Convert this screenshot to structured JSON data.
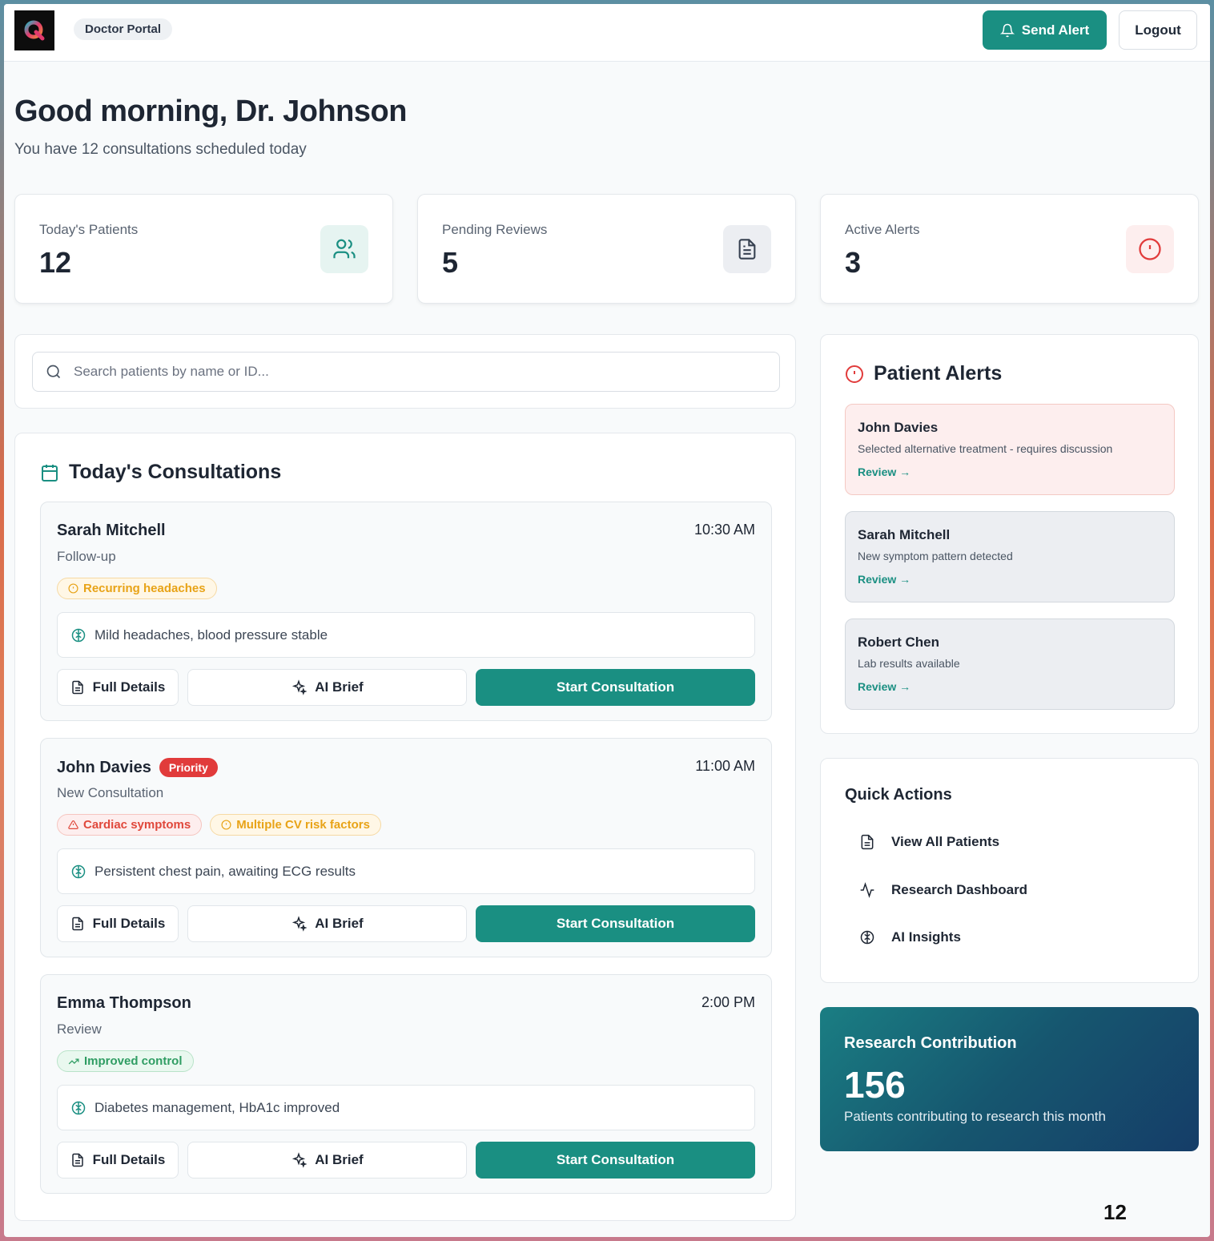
{
  "header": {
    "portal_label": "Doctor Portal",
    "send_alert_label": "Send Alert",
    "logout_label": "Logout"
  },
  "greeting": {
    "title": "Good morning, Dr. Johnson",
    "subtitle": "You have 12 consultations scheduled today"
  },
  "stats": [
    {
      "label": "Today's Patients",
      "value": "12",
      "icon": "users-icon",
      "color": "#1a8f82"
    },
    {
      "label": "Pending Reviews",
      "value": "5",
      "icon": "document-icon",
      "color": "#374151"
    },
    {
      "label": "Active Alerts",
      "value": "3",
      "icon": "alert-circle-icon",
      "color": "#e13b3b"
    }
  ],
  "search": {
    "placeholder": "Search patients by name or ID...",
    "value": ""
  },
  "consultations": {
    "title": "Today's Consultations",
    "items": [
      {
        "name": "Sarah Mitchell",
        "time": "10:30 AM",
        "kind": "Follow-up",
        "tags": [
          {
            "label": "Recurring headaches",
            "style": "warn"
          }
        ],
        "note": "Mild headaches, blood pressure stable",
        "full_details": "Full Details",
        "ai_brief": "AI Brief",
        "start": "Start Consultation"
      },
      {
        "name": "John Davies",
        "badge": "Priority",
        "time": "11:00 AM",
        "kind": "New Consultation",
        "tags": [
          {
            "label": "Cardiac symptoms",
            "style": "danger"
          },
          {
            "label": "Multiple CV risk factors",
            "style": "warn"
          }
        ],
        "note": "Persistent chest pain, awaiting ECG results",
        "full_details": "Full Details",
        "ai_brief": "AI Brief",
        "start": "Start Consultation"
      },
      {
        "name": "Emma Thompson",
        "time": "2:00 PM",
        "kind": "Review",
        "tags": [
          {
            "label": "Improved control",
            "style": "good"
          }
        ],
        "note": "Diabetes management, HbA1c improved",
        "full_details": "Full Details",
        "ai_brief": "AI Brief",
        "start": "Start Consultation"
      }
    ]
  },
  "alerts": {
    "title": "Patient Alerts",
    "items": [
      {
        "name": "John Davies",
        "desc": "Selected alternative treatment - requires discussion",
        "action": "Review →",
        "style": "red"
      },
      {
        "name": "Sarah Mitchell",
        "desc": "New symptom pattern detected",
        "action": "Review →",
        "style": "grey"
      },
      {
        "name": "Robert Chen",
        "desc": "Lab results available",
        "action": "Review →",
        "style": "grey"
      }
    ]
  },
  "quick_actions": {
    "title": "Quick Actions",
    "items": [
      {
        "label": "View All Patients",
        "icon": "document-icon"
      },
      {
        "label": "Research Dashboard",
        "icon": "activity-icon"
      },
      {
        "label": "AI Insights",
        "icon": "brain-icon"
      }
    ]
  },
  "research": {
    "title": "Research Contribution",
    "value": "156",
    "desc": "Patients contributing to research this month"
  },
  "page_number": "12",
  "colors": {
    "primary": "#1a8f82",
    "danger": "#e13b3b",
    "warn": "#e8a317",
    "good": "#2f9d63"
  }
}
